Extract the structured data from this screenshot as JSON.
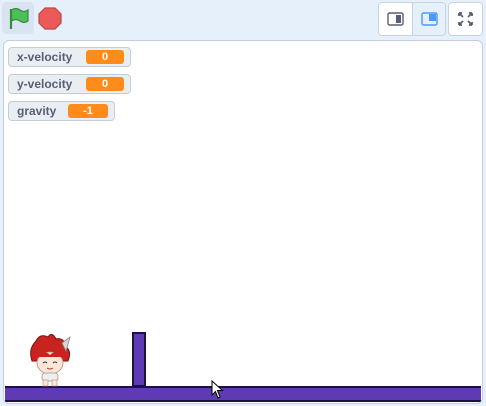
{
  "toolbar": {
    "green_flag_icon": "green-flag-icon",
    "stop_icon": "stop-sign-icon",
    "small_stage_icon": "small-stage-icon",
    "large_stage_icon": "large-stage-icon",
    "fullscreen_icon": "fullscreen-icon",
    "colors": {
      "flag": "#4cbf56",
      "stop": "#ec5959",
      "mode_active_bg": "#e6f0fb"
    }
  },
  "stage": {
    "monitors": [
      {
        "label": "x-velocity",
        "value": "0"
      },
      {
        "label": "y-velocity",
        "value": "0"
      },
      {
        "label": "gravity",
        "value": "-1"
      }
    ],
    "colors": {
      "platform": "#5e3ab5",
      "monitor_value": "#ff8c1a"
    }
  }
}
